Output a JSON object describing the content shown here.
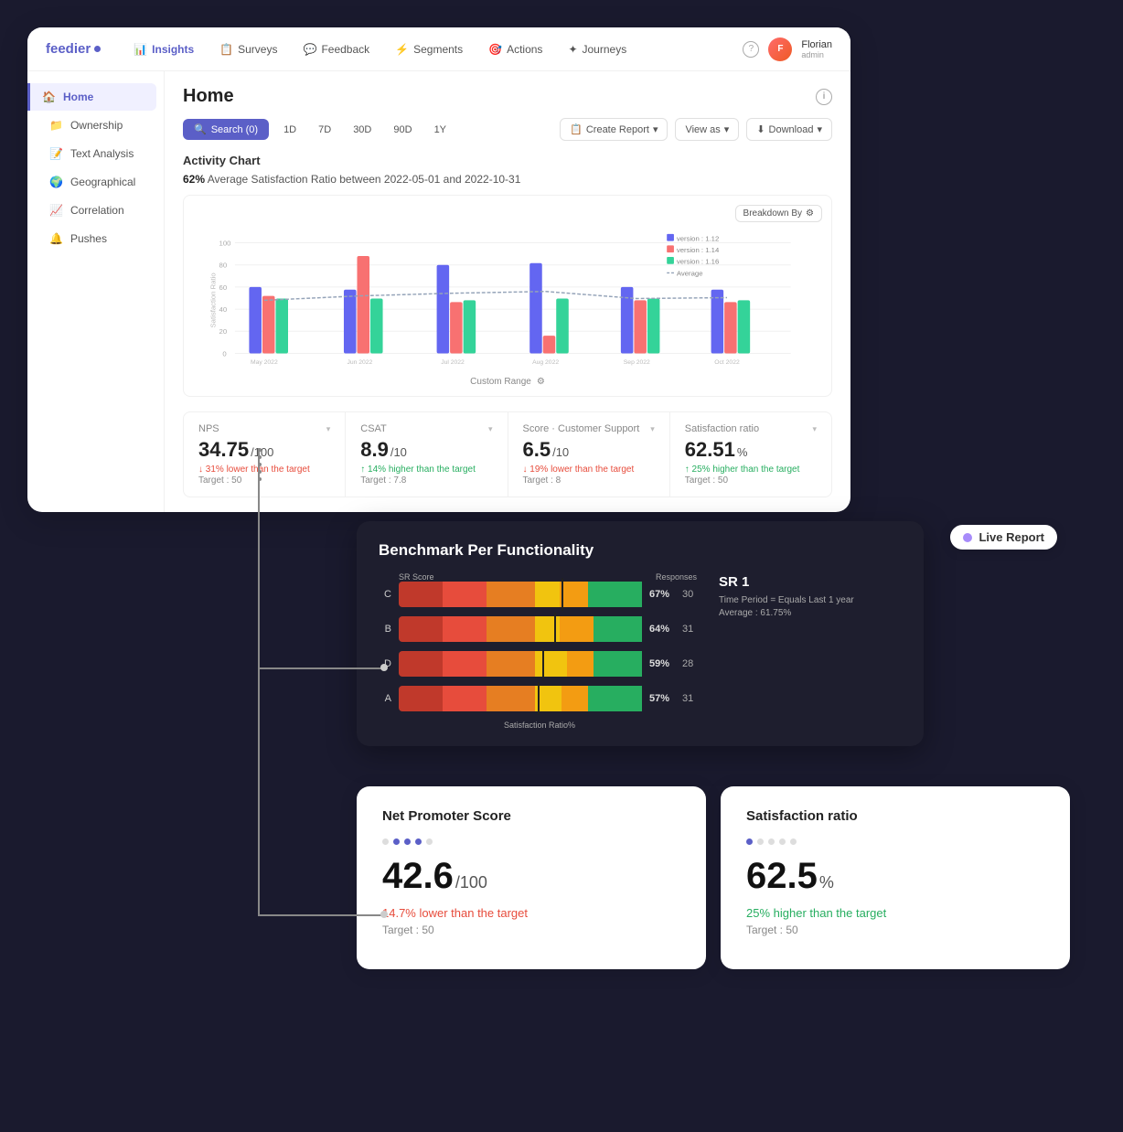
{
  "app": {
    "logo": "feedier",
    "nav_items": [
      {
        "label": "Insights",
        "icon": "📊",
        "active": true
      },
      {
        "label": "Surveys",
        "icon": "📋"
      },
      {
        "label": "Feedback",
        "icon": "💬"
      },
      {
        "label": "Segments",
        "icon": "⚡"
      },
      {
        "label": "Actions",
        "icon": "🎯"
      },
      {
        "label": "Journeys",
        "icon": "✦"
      }
    ],
    "nav_right": {
      "help": "?",
      "user_initial": "F",
      "user_name": "Florian",
      "user_role": "admin"
    }
  },
  "sidebar": {
    "items": [
      {
        "label": "Home",
        "icon": "🏠",
        "active": true
      },
      {
        "label": "Ownership",
        "icon": "📁"
      },
      {
        "label": "Text Analysis",
        "icon": "📝"
      },
      {
        "label": "Geographical",
        "icon": "🌍"
      },
      {
        "label": "Correlation",
        "icon": "📈"
      },
      {
        "label": "Pushes",
        "icon": "🔔"
      }
    ]
  },
  "page": {
    "title": "Home",
    "info": "i"
  },
  "toolbar": {
    "search_label": "Search (0)",
    "time_filters": [
      "1D",
      "7D",
      "30D",
      "90D",
      "1Y"
    ],
    "create_report": "Create Report",
    "view_as": "View as",
    "download": "Download"
  },
  "activity_chart": {
    "title": "Activity Chart",
    "percent": "62%",
    "subtitle": "Average Satisfaction Ratio between 2022-05-01 and 2022-10-31",
    "breakdown_label": "Breakdown By",
    "custom_range": "Custom Range",
    "legend": [
      {
        "label": "version : 1.12",
        "color": "#6366f1"
      },
      {
        "label": "version : 1.14",
        "color": "#f87171"
      },
      {
        "label": "version : 1.16",
        "color": "#34d399"
      },
      {
        "label": "Average",
        "color": "#94a3b8"
      }
    ],
    "months": [
      "May 2022",
      "Jun 2022",
      "Jul 2022",
      "Aug 2022",
      "Sep 2022",
      "Oct 2022"
    ],
    "y_axis": [
      "100",
      "80",
      "60",
      "40",
      "20",
      "0"
    ]
  },
  "metrics": [
    {
      "label": "NPS",
      "value": "34.75",
      "denom": "/100",
      "delta": "↓ 31% lower than the target",
      "delta_dir": "down",
      "target": "Target : 50"
    },
    {
      "label": "CSAT",
      "value": "8.9",
      "denom": "/10",
      "delta": "↑ 14% higher than the target",
      "delta_dir": "up",
      "target": "Target : 7.8"
    },
    {
      "label": "Score · Customer Support",
      "value": "6.5",
      "denom": "/10",
      "delta": "↓ 19% lower than the target",
      "delta_dir": "down",
      "target": "Target : 8"
    },
    {
      "label": "Satisfaction ratio",
      "value": "62.51",
      "denom": "%",
      "delta": "↑ 25% higher than the target",
      "delta_dir": "up",
      "target": "Target : 50"
    }
  ],
  "benchmark": {
    "title": "Benchmark Per Functionality",
    "col_headers": [
      "SR Score",
      "Responses"
    ],
    "sr_title": "SR 1",
    "sr_time": "Time Period = Equals Last 1 year",
    "sr_average": "Average : 61.75%",
    "rows": [
      {
        "label": "C",
        "pct": "67%",
        "responses": "30"
      },
      {
        "label": "B",
        "pct": "64%",
        "responses": "31"
      },
      {
        "label": "D",
        "pct": "59%",
        "responses": "28"
      },
      {
        "label": "A",
        "pct": "57%",
        "responses": "31"
      }
    ],
    "x_label": "Satisfaction Ratio%"
  },
  "live_report": {
    "label": "Live Report",
    "dot_color": "#a78bfa"
  },
  "bottom_cards": [
    {
      "title": "Net Promoter Score",
      "value": "42.6",
      "denom": "/100",
      "delta": "14.7% lower than the target",
      "delta_dir": "down",
      "target": "Target : 50",
      "dots": [
        false,
        true,
        true,
        true,
        false
      ]
    },
    {
      "title": "Satisfaction ratio",
      "value": "62.5",
      "denom": "%",
      "delta": "25% higher than the target",
      "delta_dir": "up",
      "target": "Target : 50",
      "dots": [
        true,
        false,
        false,
        false,
        false
      ]
    }
  ]
}
